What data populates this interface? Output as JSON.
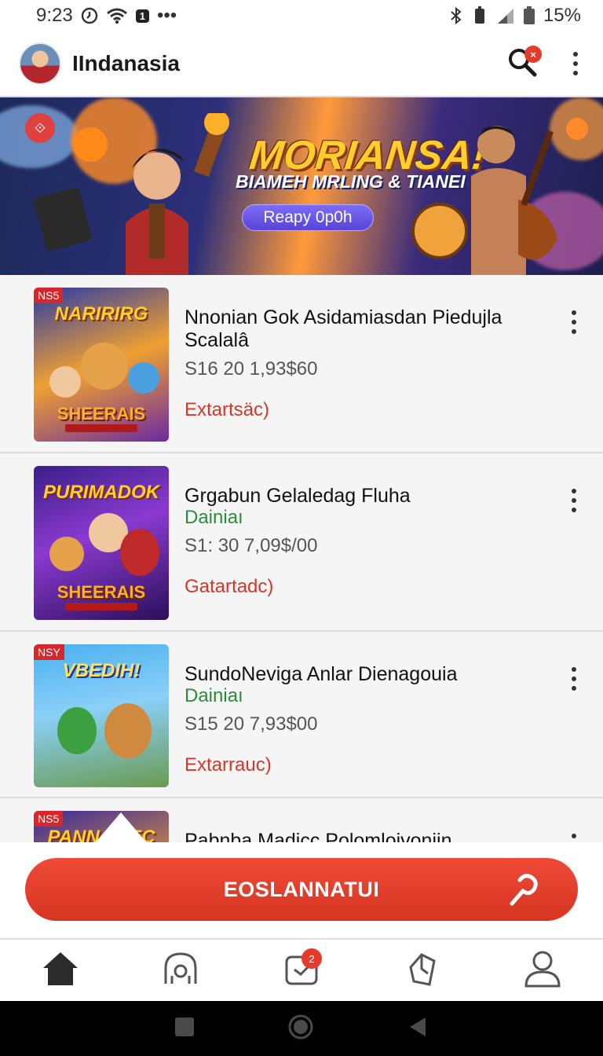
{
  "status_bar": {
    "time": "9:23",
    "notification_count": "1",
    "dots": "•••",
    "battery": "15%"
  },
  "header": {
    "title": "IIndanasia",
    "search_badge": "×"
  },
  "banner": {
    "headline": "MORIANSA!",
    "subline": "BIAMEH MRLING & TIANEI",
    "cta_label": "Reapy 0p0h"
  },
  "items": [
    {
      "tag": "NS5",
      "thumb_title": "NARIRIRG",
      "thumb_bottom": "SHEERAIS",
      "title": "Nnonian Gok Asidamiasdan Piedujla Scalalâ",
      "subtitle": "",
      "price": "S16 20 1,93$60",
      "action": "Extartsäc)"
    },
    {
      "tag": "",
      "thumb_title": "PURIMADOK",
      "thumb_bottom": "SHEERAIS",
      "title": "Grgabun Gelaledag Fluha",
      "subtitle": "Dainiaı",
      "price": "S1: 30 7,09$/00",
      "action": "Gatartadc)"
    },
    {
      "tag": "NSY",
      "thumb_title": "VBEDIH!",
      "thumb_bottom": "",
      "title": "SundoNeviga Anlar Dienagouia",
      "subtitle": "Dainiaı",
      "price": "S15 20 7,93$00",
      "action": "Extarrauc)"
    },
    {
      "tag": "NS5",
      "thumb_title": "PANNAMEC",
      "thumb_bottom": "",
      "title": "Pabnba Madicc Polomloivoniin",
      "subtitle": "",
      "price": "",
      "action": ""
    }
  ],
  "cta": {
    "label": "EOSLANNATUI"
  },
  "bottom_nav": {
    "items": [
      "home-icon",
      "support-icon",
      "notifications-icon",
      "bookmark-icon",
      "profile-icon"
    ],
    "badge": "2"
  },
  "colors": {
    "accent": "#E53B2C",
    "green": "#2A8C3A",
    "price_gray": "#555555"
  }
}
